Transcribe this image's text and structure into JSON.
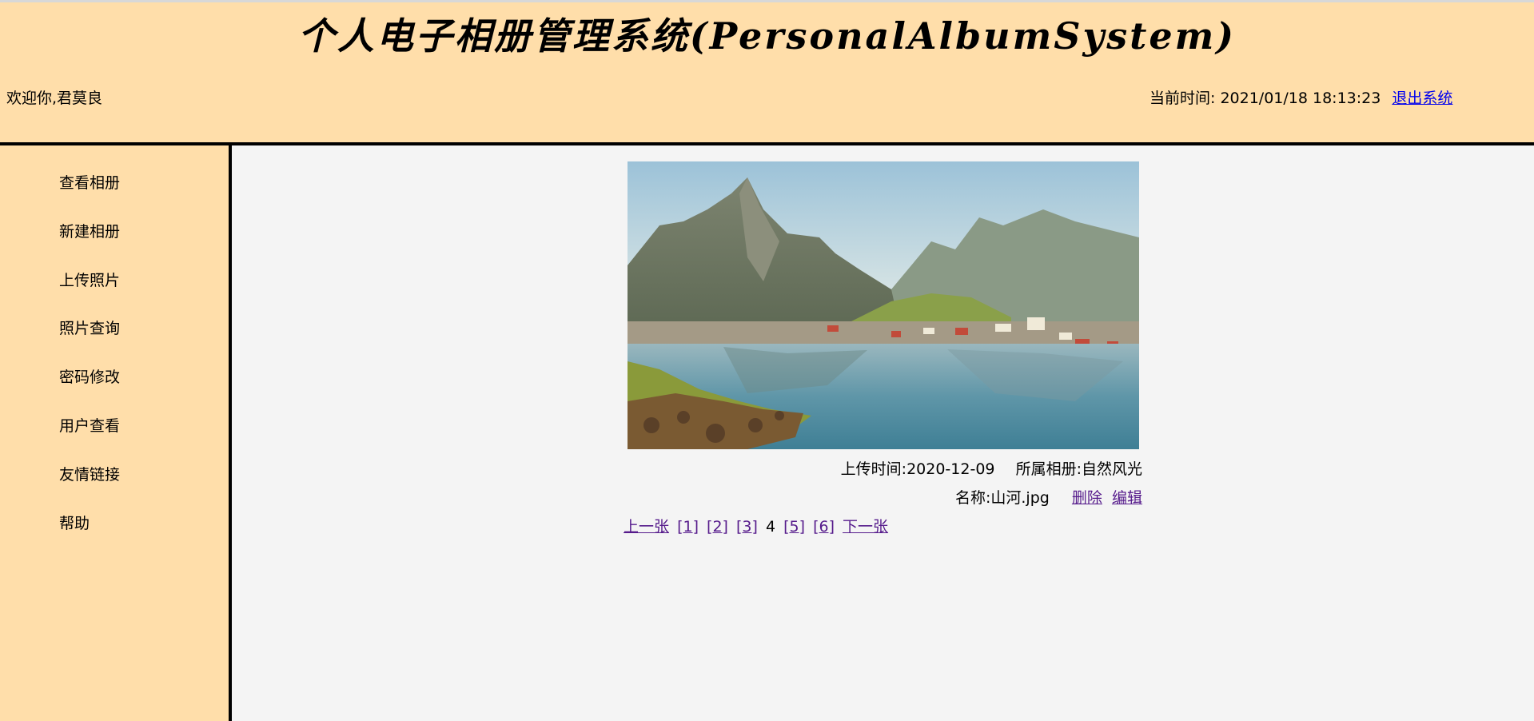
{
  "header": {
    "title": "个人电子相册管理系统(PersonalAlbumSystem)",
    "welcome": "欢迎你,君莫良",
    "time_label": "当前时间: 2021/01/18 18:13:23",
    "logout": "退出系统"
  },
  "sidebar": {
    "items": [
      {
        "label": "查看相册"
      },
      {
        "label": "新建相册"
      },
      {
        "label": "上传照片"
      },
      {
        "label": "照片查询"
      },
      {
        "label": "密码修改"
      },
      {
        "label": "用户查看"
      },
      {
        "label": "友情链接"
      },
      {
        "label": "帮助"
      }
    ]
  },
  "photo": {
    "upload_time": "上传时间:2020-12-09",
    "album": "所属相册:自然风光",
    "name": "名称:山河.jpg",
    "delete": "删除",
    "edit": "编辑"
  },
  "pager": {
    "prev": "上一张",
    "pages": [
      "[1]",
      "[2]",
      "[3]"
    ],
    "current": "4",
    "pages_after": [
      "[5]",
      "[6]"
    ],
    "next": "下一张"
  },
  "colors": {
    "panel": "#ffdeaa",
    "content_bg": "#f4f4f4",
    "link": "#0000ee",
    "visited_link": "#551a8b"
  }
}
